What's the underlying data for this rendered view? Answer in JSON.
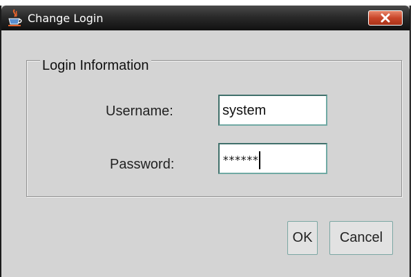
{
  "window": {
    "title": "Change Login",
    "app_icon": "java-cup-icon",
    "close_icon": "close-icon"
  },
  "group": {
    "legend": "Login Information"
  },
  "form": {
    "username_label": "Username:",
    "username_value": "system",
    "password_label": "Password:",
    "password_value": "******"
  },
  "buttons": {
    "ok_label": "OK",
    "cancel_label": "Cancel"
  },
  "colors": {
    "dialog_background": "#d4d4d4",
    "titlebar": "#1e1e1e",
    "close_button": "#c9462a",
    "field_border": "#6fa9a3"
  }
}
